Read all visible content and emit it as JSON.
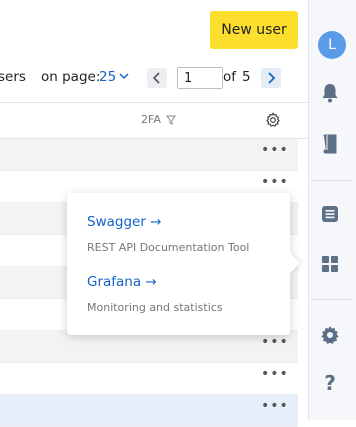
{
  "header": {
    "new_user_label": "New user",
    "avatar_initial": "L"
  },
  "pager": {
    "users_label": "sers",
    "on_page_label": "on page:",
    "on_page_value": "25",
    "current_page": "1",
    "of_label": "of",
    "total_pages": "5"
  },
  "table": {
    "column_2fa": "2FA",
    "row_action": "•••"
  },
  "popup": {
    "items": [
      {
        "link": "Swagger →",
        "description": "REST API Documentation Tool"
      },
      {
        "link": "Grafana →",
        "description": "Monitoring and statistics"
      }
    ]
  },
  "rail": {
    "icons": [
      "bell-icon",
      "book-icon",
      "list-icon",
      "grid-icon",
      "gear-icon",
      "help-icon"
    ],
    "help_glyph": "?"
  },
  "colors": {
    "accent": "#fcdf2c",
    "link": "#1463c8",
    "rail_icon": "#5b6f86",
    "avatar": "#5a9be8",
    "selected_row": "#e5eef9"
  }
}
